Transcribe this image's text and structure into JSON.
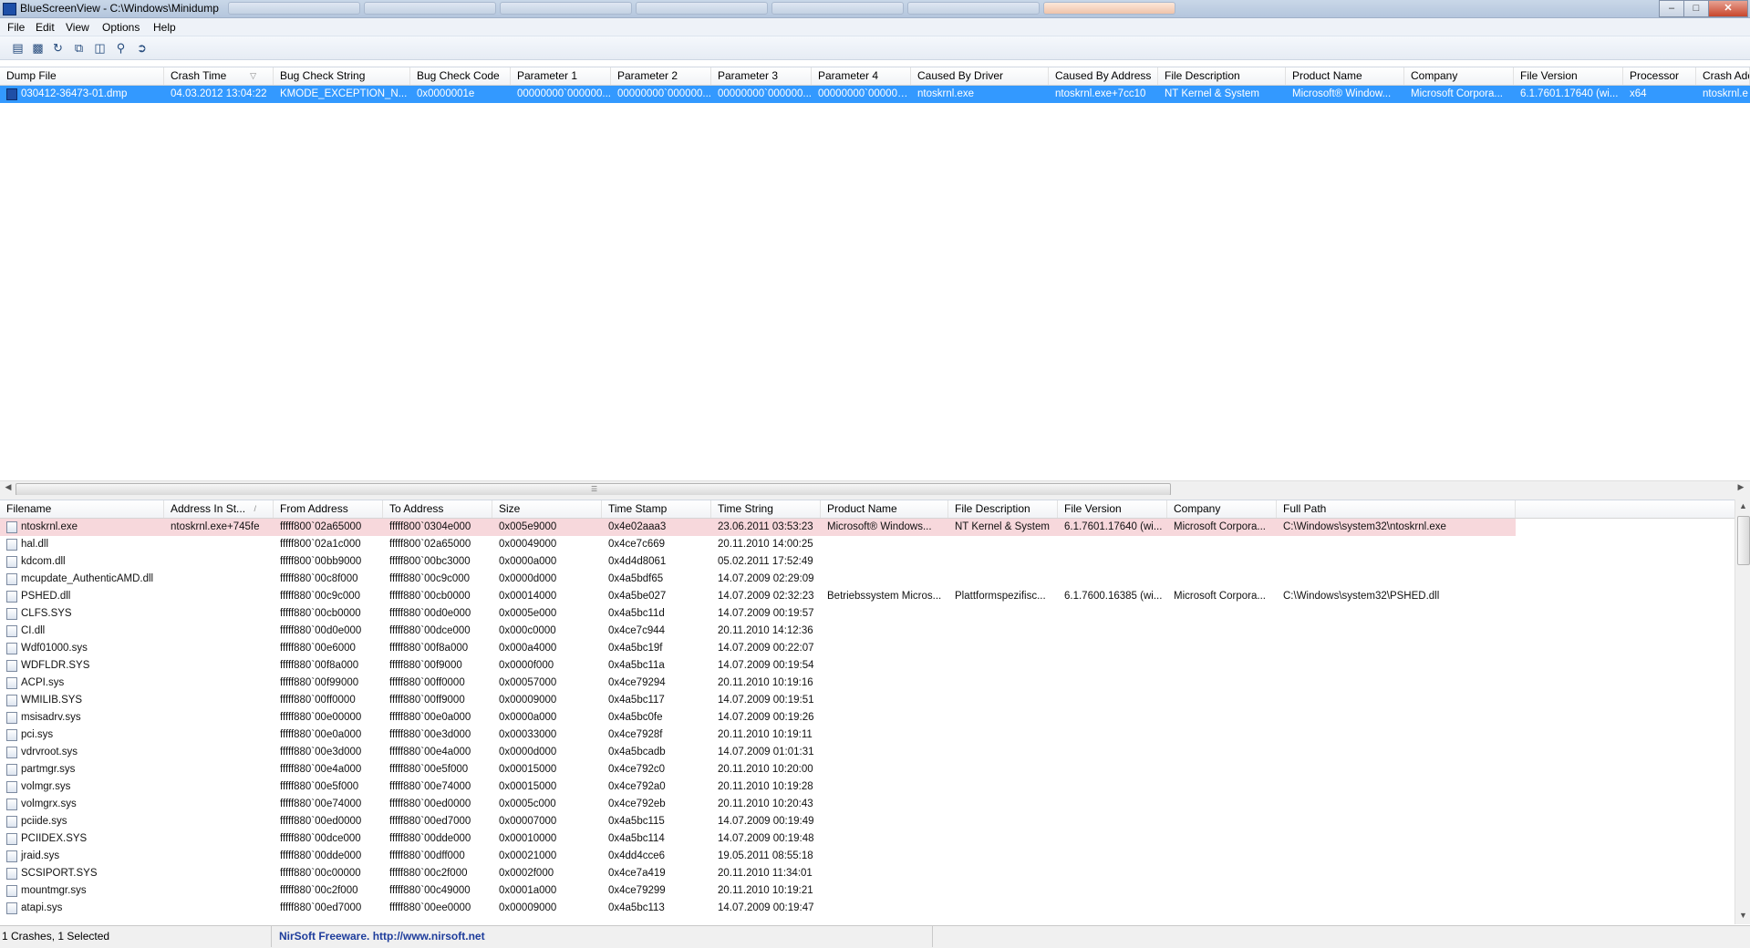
{
  "window": {
    "title": "BlueScreenView  -  C:\\Windows\\Minidump"
  },
  "menu": [
    "File",
    "Edit",
    "View",
    "Options",
    "Help"
  ],
  "toolbar": {
    "icons": [
      "properties-icon",
      "save-icon",
      "refresh-icon",
      "copy-icon",
      "report-icon",
      "find-icon",
      "exit-icon"
    ]
  },
  "crash_list": {
    "columns": [
      "Dump File",
      "Crash Time",
      "Bug Check String",
      "Bug Check Code",
      "Parameter 1",
      "Parameter 2",
      "Parameter 3",
      "Parameter 4",
      "Caused By Driver",
      "Caused By Address",
      "File Description",
      "Product Name",
      "Company",
      "File Version",
      "Processor",
      "Crash Add"
    ],
    "rows": [
      [
        "030412-36473-01.dmp",
        "04.03.2012 13:04:22",
        "KMODE_EXCEPTION_N...",
        "0x0000001e",
        "00000000`000000...",
        "00000000`000000...",
        "00000000`000000...",
        "00000000`000000...",
        "ntoskrnl.exe",
        "ntoskrnl.exe+7cc10",
        "NT Kernel & System",
        "Microsoft® Window...",
        "Microsoft Corpora...",
        "6.1.7601.17640 (wi...",
        "x64",
        "ntoskrnl.e"
      ]
    ]
  },
  "driver_list": {
    "columns": [
      "Filename",
      "Address In St...",
      "From Address",
      "To Address",
      "Size",
      "Time Stamp",
      "Time String",
      "Product Name",
      "File Description",
      "File Version",
      "Company",
      "Full Path"
    ],
    "rows": [
      [
        "ntoskrnl.exe",
        "ntoskrnl.exe+745fe",
        "fffff800`02a65000",
        "fffff800`0304e000",
        "0x005e9000",
        "0x4e02aaa3",
        "23.06.2011 03:53:23",
        "Microsoft® Windows...",
        "NT Kernel & System",
        "6.1.7601.17640 (wi...",
        "Microsoft Corpora...",
        "C:\\Windows\\system32\\ntoskrnl.exe"
      ],
      [
        "hal.dll",
        "",
        "fffff800`02a1c000",
        "fffff800`02a65000",
        "0x00049000",
        "0x4ce7c669",
        "20.11.2010 14:00:25",
        "",
        "",
        "",
        "",
        ""
      ],
      [
        "kdcom.dll",
        "",
        "fffff800`00bb9000",
        "fffff800`00bc3000",
        "0x0000a000",
        "0x4d4d8061",
        "05.02.2011 17:52:49",
        "",
        "",
        "",
        "",
        ""
      ],
      [
        "mcupdate_AuthenticAMD.dll",
        "",
        "fffff880`00c8f000",
        "fffff880`00c9c000",
        "0x0000d000",
        "0x4a5bdf65",
        "14.07.2009 02:29:09",
        "",
        "",
        "",
        "",
        ""
      ],
      [
        "PSHED.dll",
        "",
        "fffff880`00c9c000",
        "fffff880`00cb0000",
        "0x00014000",
        "0x4a5be027",
        "14.07.2009 02:32:23",
        "Betriebssystem Micros...",
        "Plattformspezifisc...",
        "6.1.7600.16385 (wi...",
        "Microsoft Corpora...",
        "C:\\Windows\\system32\\PSHED.dll"
      ],
      [
        "CLFS.SYS",
        "",
        "fffff880`00cb0000",
        "fffff880`00d0e000",
        "0x0005e000",
        "0x4a5bc11d",
        "14.07.2009 00:19:57",
        "",
        "",
        "",
        "",
        ""
      ],
      [
        "CI.dll",
        "",
        "fffff880`00d0e000",
        "fffff880`00dce000",
        "0x000c0000",
        "0x4ce7c944",
        "20.11.2010 14:12:36",
        "",
        "",
        "",
        "",
        ""
      ],
      [
        "Wdf01000.sys",
        "",
        "fffff880`00e6000",
        "fffff880`00f8a000",
        "0x000a4000",
        "0x4a5bc19f",
        "14.07.2009 00:22:07",
        "",
        "",
        "",
        "",
        ""
      ],
      [
        "WDFLDR.SYS",
        "",
        "fffff880`00f8a000",
        "fffff880`00f9000",
        "0x0000f000",
        "0x4a5bc11a",
        "14.07.2009 00:19:54",
        "",
        "",
        "",
        "",
        ""
      ],
      [
        "ACPI.sys",
        "",
        "fffff880`00f99000",
        "fffff880`00ff0000",
        "0x00057000",
        "0x4ce79294",
        "20.11.2010 10:19:16",
        "",
        "",
        "",
        "",
        ""
      ],
      [
        "WMILIB.SYS",
        "",
        "fffff880`00ff0000",
        "fffff880`00ff9000",
        "0x00009000",
        "0x4a5bc117",
        "14.07.2009 00:19:51",
        "",
        "",
        "",
        "",
        ""
      ],
      [
        "msisadrv.sys",
        "",
        "fffff880`00e00000",
        "fffff880`00e0a000",
        "0x0000a000",
        "0x4a5bc0fe",
        "14.07.2009 00:19:26",
        "",
        "",
        "",
        "",
        ""
      ],
      [
        "pci.sys",
        "",
        "fffff880`00e0a000",
        "fffff880`00e3d000",
        "0x00033000",
        "0x4ce7928f",
        "20.11.2010 10:19:11",
        "",
        "",
        "",
        "",
        ""
      ],
      [
        "vdrvroot.sys",
        "",
        "fffff880`00e3d000",
        "fffff880`00e4a000",
        "0x0000d000",
        "0x4a5bcadb",
        "14.07.2009 01:01:31",
        "",
        "",
        "",
        "",
        ""
      ],
      [
        "partmgr.sys",
        "",
        "fffff880`00e4a000",
        "fffff880`00e5f000",
        "0x00015000",
        "0x4ce792c0",
        "20.11.2010 10:20:00",
        "",
        "",
        "",
        "",
        ""
      ],
      [
        "volmgr.sys",
        "",
        "fffff880`00e5f000",
        "fffff880`00e74000",
        "0x00015000",
        "0x4ce792a0",
        "20.11.2010 10:19:28",
        "",
        "",
        "",
        "",
        ""
      ],
      [
        "volmgrx.sys",
        "",
        "fffff880`00e74000",
        "fffff880`00ed0000",
        "0x0005c000",
        "0x4ce792eb",
        "20.11.2010 10:20:43",
        "",
        "",
        "",
        "",
        ""
      ],
      [
        "pciide.sys",
        "",
        "fffff880`00ed0000",
        "fffff880`00ed7000",
        "0x00007000",
        "0x4a5bc115",
        "14.07.2009 00:19:49",
        "",
        "",
        "",
        "",
        ""
      ],
      [
        "PCIIDEX.SYS",
        "",
        "fffff880`00dce000",
        "fffff880`00dde000",
        "0x00010000",
        "0x4a5bc114",
        "14.07.2009 00:19:48",
        "",
        "",
        "",
        "",
        ""
      ],
      [
        "jraid.sys",
        "",
        "fffff880`00dde000",
        "fffff880`00dff000",
        "0x00021000",
        "0x4dd4cce6",
        "19.05.2011 08:55:18",
        "",
        "",
        "",
        "",
        ""
      ],
      [
        "SCSIPORT.SYS",
        "",
        "fffff880`00c00000",
        "fffff880`00c2f000",
        "0x0002f000",
        "0x4ce7a419",
        "20.11.2010 11:34:01",
        "",
        "",
        "",
        "",
        ""
      ],
      [
        "mountmgr.sys",
        "",
        "fffff880`00c2f000",
        "fffff880`00c49000",
        "0x0001a000",
        "0x4ce79299",
        "20.11.2010 10:19:21",
        "",
        "",
        "",
        "",
        ""
      ],
      [
        "atapi.sys",
        "",
        "fffff880`00ed7000",
        "fffff880`00ee0000",
        "0x00009000",
        "0x4a5bc113",
        "14.07.2009 00:19:47",
        "",
        "",
        "",
        "",
        ""
      ]
    ]
  },
  "status": {
    "count_text": "1 Crashes, 1 Selected",
    "link_text": "NirSoft Freeware.  http://www.nirsoft.net"
  },
  "colors": {
    "selection": "#3399ff",
    "highlight_row": "#f7d8dc",
    "link": "#1e3d9c"
  }
}
